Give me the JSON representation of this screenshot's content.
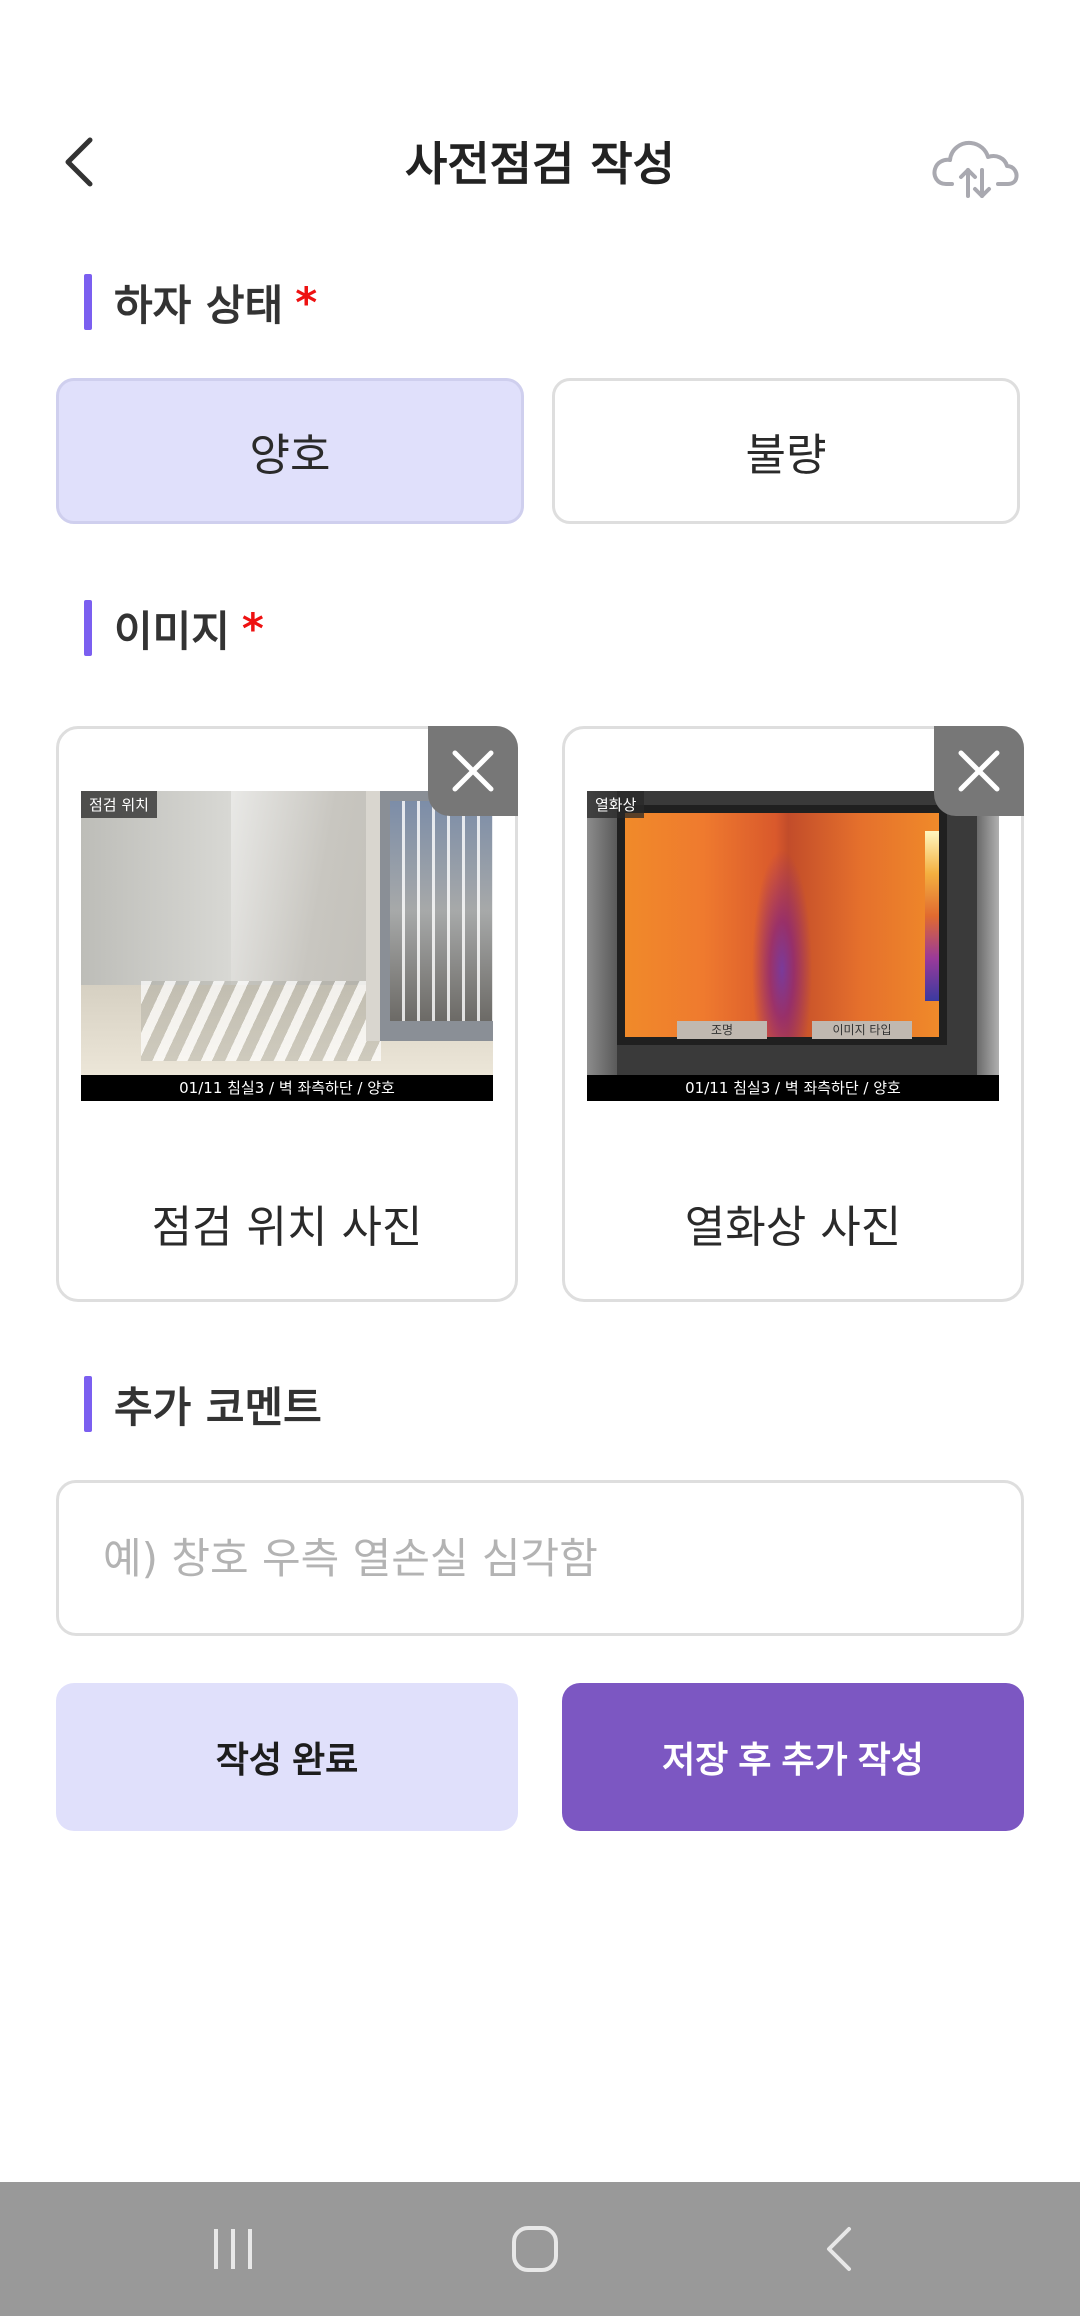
{
  "header": {
    "title": "사전점검 작성",
    "back_icon": "chevron-left-icon",
    "upload_icon": "cloud-upload-icon"
  },
  "defect_status": {
    "label": "하자 상태",
    "required_mark": "*",
    "options": [
      "양호",
      "불량"
    ],
    "selected": "양호"
  },
  "images": {
    "label": "이미지",
    "required_mark": "*",
    "cards": [
      {
        "tag": "점검 위치",
        "stamp": "01/11 침실3 / 벽 좌측하단 / 양호",
        "label": "점검 위치 사진"
      },
      {
        "tag": "열화상",
        "stamp": "01/11 침실3 / 벽 좌측하단 / 양호",
        "label": "열화상 사진",
        "overlay_left": "조명",
        "overlay_right": "이미지 타입"
      }
    ]
  },
  "comment": {
    "label": "추가 코멘트",
    "placeholder": "예) 창호 우측 열손실 심각함",
    "value": ""
  },
  "actions": {
    "complete": "작성 완료",
    "save_and_add": "저장 후 추가 작성"
  },
  "system_nav": {
    "recents_icon": "recents-icon",
    "home_icon": "home-icon",
    "back_icon": "back-icon"
  },
  "colors": {
    "accent": "#7b5ff0",
    "primary_button": "#7c57c2",
    "selected_bg": "#e0e0fb",
    "required": "#e11111",
    "nav_bar": "#999999"
  }
}
